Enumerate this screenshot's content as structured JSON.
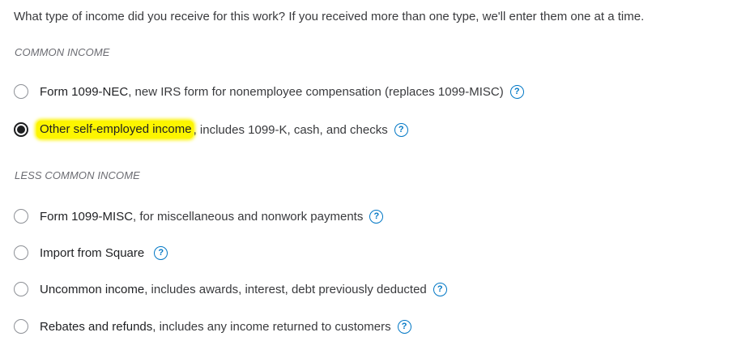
{
  "question": "What type of income did you receive for this work? If you received more than one type, we'll enter them one at a time.",
  "sections": {
    "common": "COMMON INCOME",
    "less_common": "LESS COMMON INCOME"
  },
  "options": {
    "nec": {
      "main": "Form 1099-NEC",
      "desc": ", new IRS form for nonemployee compensation (replaces 1099-MISC)",
      "selected": false
    },
    "self": {
      "main": "Other self-employed income",
      "desc": ", includes 1099-K, cash, and checks",
      "selected": true
    },
    "misc": {
      "main": "Form 1099-MISC",
      "desc": ", for miscellaneous and nonwork payments",
      "selected": false
    },
    "square": {
      "main": "Import from Square",
      "desc": "",
      "selected": false
    },
    "uncommon": {
      "main": "Uncommon income",
      "desc": ", includes awards, interest, debt previously deducted",
      "selected": false
    },
    "rebates": {
      "main": "Rebates and refunds",
      "desc": ", includes any income returned to customers",
      "selected": false
    }
  },
  "help_glyph": "?",
  "colors": {
    "accent": "#0077c5",
    "highlight": "#fdf500",
    "text": "#393a3d",
    "section": "#6b6c72"
  },
  "icons": {
    "help": "question-circle-icon"
  }
}
